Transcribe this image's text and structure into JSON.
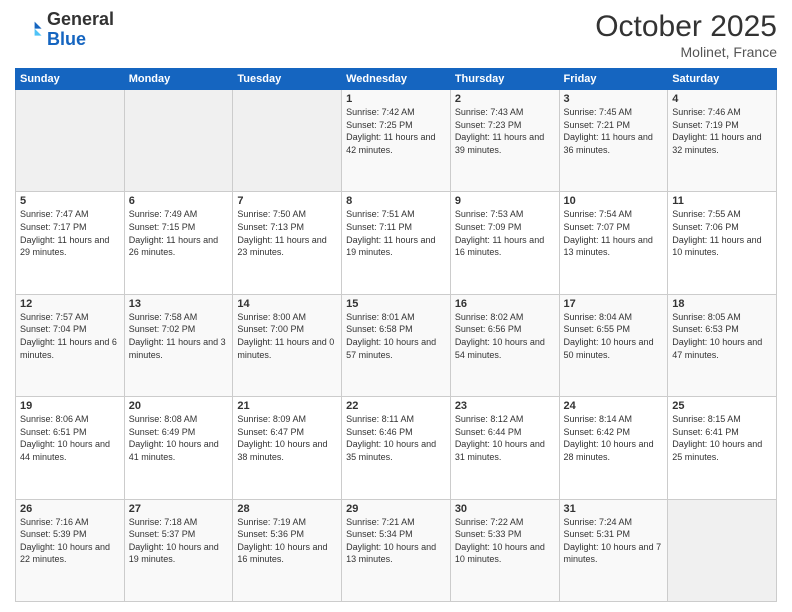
{
  "header": {
    "logo_general": "General",
    "logo_blue": "Blue",
    "month_title": "October 2025",
    "location": "Molinet, France"
  },
  "weekdays": [
    "Sunday",
    "Monday",
    "Tuesday",
    "Wednesday",
    "Thursday",
    "Friday",
    "Saturday"
  ],
  "weeks": [
    [
      {
        "day": "",
        "sunrise": "",
        "sunset": "",
        "daylight": ""
      },
      {
        "day": "",
        "sunrise": "",
        "sunset": "",
        "daylight": ""
      },
      {
        "day": "",
        "sunrise": "",
        "sunset": "",
        "daylight": ""
      },
      {
        "day": "1",
        "sunrise": "Sunrise: 7:42 AM",
        "sunset": "Sunset: 7:25 PM",
        "daylight": "Daylight: 11 hours and 42 minutes."
      },
      {
        "day": "2",
        "sunrise": "Sunrise: 7:43 AM",
        "sunset": "Sunset: 7:23 PM",
        "daylight": "Daylight: 11 hours and 39 minutes."
      },
      {
        "day": "3",
        "sunrise": "Sunrise: 7:45 AM",
        "sunset": "Sunset: 7:21 PM",
        "daylight": "Daylight: 11 hours and 36 minutes."
      },
      {
        "day": "4",
        "sunrise": "Sunrise: 7:46 AM",
        "sunset": "Sunset: 7:19 PM",
        "daylight": "Daylight: 11 hours and 32 minutes."
      }
    ],
    [
      {
        "day": "5",
        "sunrise": "Sunrise: 7:47 AM",
        "sunset": "Sunset: 7:17 PM",
        "daylight": "Daylight: 11 hours and 29 minutes."
      },
      {
        "day": "6",
        "sunrise": "Sunrise: 7:49 AM",
        "sunset": "Sunset: 7:15 PM",
        "daylight": "Daylight: 11 hours and 26 minutes."
      },
      {
        "day": "7",
        "sunrise": "Sunrise: 7:50 AM",
        "sunset": "Sunset: 7:13 PM",
        "daylight": "Daylight: 11 hours and 23 minutes."
      },
      {
        "day": "8",
        "sunrise": "Sunrise: 7:51 AM",
        "sunset": "Sunset: 7:11 PM",
        "daylight": "Daylight: 11 hours and 19 minutes."
      },
      {
        "day": "9",
        "sunrise": "Sunrise: 7:53 AM",
        "sunset": "Sunset: 7:09 PM",
        "daylight": "Daylight: 11 hours and 16 minutes."
      },
      {
        "day": "10",
        "sunrise": "Sunrise: 7:54 AM",
        "sunset": "Sunset: 7:07 PM",
        "daylight": "Daylight: 11 hours and 13 minutes."
      },
      {
        "day": "11",
        "sunrise": "Sunrise: 7:55 AM",
        "sunset": "Sunset: 7:06 PM",
        "daylight": "Daylight: 11 hours and 10 minutes."
      }
    ],
    [
      {
        "day": "12",
        "sunrise": "Sunrise: 7:57 AM",
        "sunset": "Sunset: 7:04 PM",
        "daylight": "Daylight: 11 hours and 6 minutes."
      },
      {
        "day": "13",
        "sunrise": "Sunrise: 7:58 AM",
        "sunset": "Sunset: 7:02 PM",
        "daylight": "Daylight: 11 hours and 3 minutes."
      },
      {
        "day": "14",
        "sunrise": "Sunrise: 8:00 AM",
        "sunset": "Sunset: 7:00 PM",
        "daylight": "Daylight: 11 hours and 0 minutes."
      },
      {
        "day": "15",
        "sunrise": "Sunrise: 8:01 AM",
        "sunset": "Sunset: 6:58 PM",
        "daylight": "Daylight: 10 hours and 57 minutes."
      },
      {
        "day": "16",
        "sunrise": "Sunrise: 8:02 AM",
        "sunset": "Sunset: 6:56 PM",
        "daylight": "Daylight: 10 hours and 54 minutes."
      },
      {
        "day": "17",
        "sunrise": "Sunrise: 8:04 AM",
        "sunset": "Sunset: 6:55 PM",
        "daylight": "Daylight: 10 hours and 50 minutes."
      },
      {
        "day": "18",
        "sunrise": "Sunrise: 8:05 AM",
        "sunset": "Sunset: 6:53 PM",
        "daylight": "Daylight: 10 hours and 47 minutes."
      }
    ],
    [
      {
        "day": "19",
        "sunrise": "Sunrise: 8:06 AM",
        "sunset": "Sunset: 6:51 PM",
        "daylight": "Daylight: 10 hours and 44 minutes."
      },
      {
        "day": "20",
        "sunrise": "Sunrise: 8:08 AM",
        "sunset": "Sunset: 6:49 PM",
        "daylight": "Daylight: 10 hours and 41 minutes."
      },
      {
        "day": "21",
        "sunrise": "Sunrise: 8:09 AM",
        "sunset": "Sunset: 6:47 PM",
        "daylight": "Daylight: 10 hours and 38 minutes."
      },
      {
        "day": "22",
        "sunrise": "Sunrise: 8:11 AM",
        "sunset": "Sunset: 6:46 PM",
        "daylight": "Daylight: 10 hours and 35 minutes."
      },
      {
        "day": "23",
        "sunrise": "Sunrise: 8:12 AM",
        "sunset": "Sunset: 6:44 PM",
        "daylight": "Daylight: 10 hours and 31 minutes."
      },
      {
        "day": "24",
        "sunrise": "Sunrise: 8:14 AM",
        "sunset": "Sunset: 6:42 PM",
        "daylight": "Daylight: 10 hours and 28 minutes."
      },
      {
        "day": "25",
        "sunrise": "Sunrise: 8:15 AM",
        "sunset": "Sunset: 6:41 PM",
        "daylight": "Daylight: 10 hours and 25 minutes."
      }
    ],
    [
      {
        "day": "26",
        "sunrise": "Sunrise: 7:16 AM",
        "sunset": "Sunset: 5:39 PM",
        "daylight": "Daylight: 10 hours and 22 minutes."
      },
      {
        "day": "27",
        "sunrise": "Sunrise: 7:18 AM",
        "sunset": "Sunset: 5:37 PM",
        "daylight": "Daylight: 10 hours and 19 minutes."
      },
      {
        "day": "28",
        "sunrise": "Sunrise: 7:19 AM",
        "sunset": "Sunset: 5:36 PM",
        "daylight": "Daylight: 10 hours and 16 minutes."
      },
      {
        "day": "29",
        "sunrise": "Sunrise: 7:21 AM",
        "sunset": "Sunset: 5:34 PM",
        "daylight": "Daylight: 10 hours and 13 minutes."
      },
      {
        "day": "30",
        "sunrise": "Sunrise: 7:22 AM",
        "sunset": "Sunset: 5:33 PM",
        "daylight": "Daylight: 10 hours and 10 minutes."
      },
      {
        "day": "31",
        "sunrise": "Sunrise: 7:24 AM",
        "sunset": "Sunset: 5:31 PM",
        "daylight": "Daylight: 10 hours and 7 minutes."
      },
      {
        "day": "",
        "sunrise": "",
        "sunset": "",
        "daylight": ""
      }
    ]
  ]
}
